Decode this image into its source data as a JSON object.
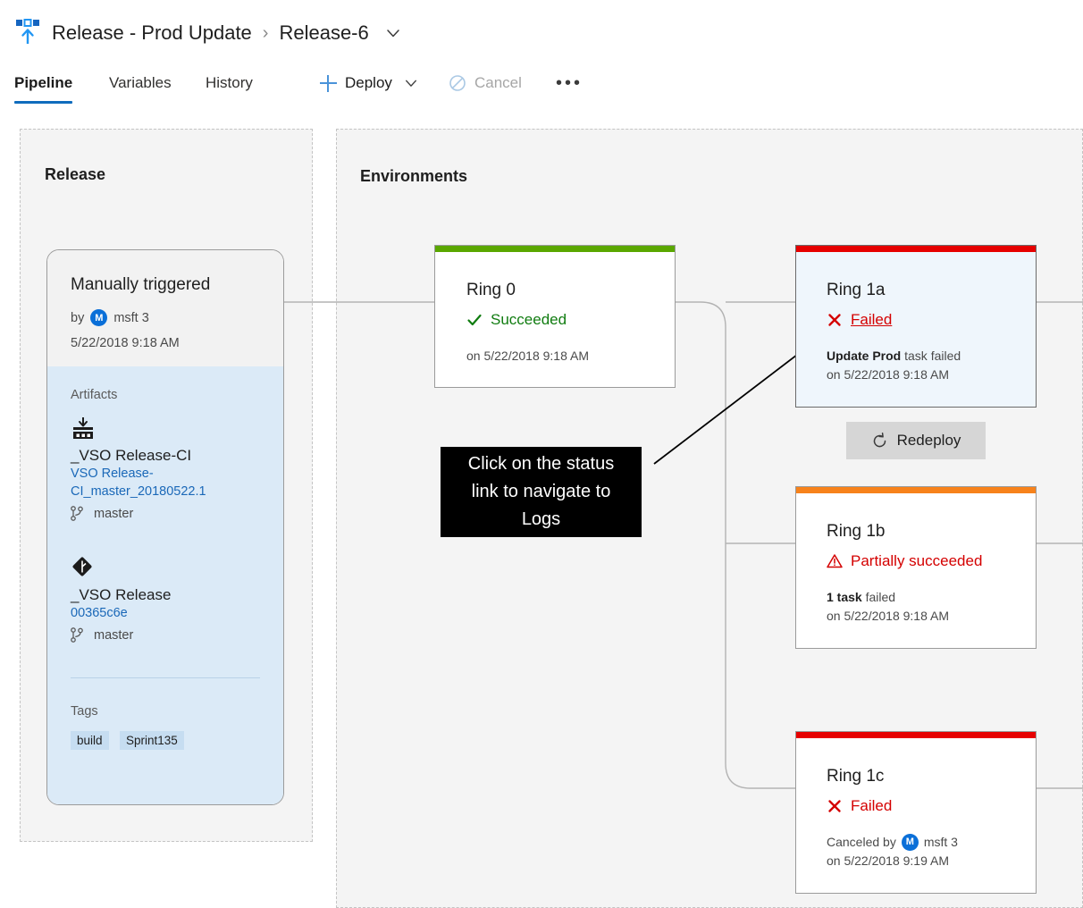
{
  "header": {
    "app_icon": "release-pipeline-icon",
    "breadcrumb_root": "Release - Prod Update",
    "breadcrumb_separator": "›",
    "breadcrumb_current": "Release-6",
    "caret_icon": "chevron-down-icon"
  },
  "tabs": [
    {
      "label": "Pipeline",
      "active": true
    },
    {
      "label": "Variables",
      "active": false
    },
    {
      "label": "History",
      "active": false
    }
  ],
  "toolbar": {
    "deploy_label": "Deploy",
    "deploy_icon": "plus-icon",
    "deploy_caret_icon": "chevron-down-icon",
    "cancel_label": "Cancel",
    "cancel_icon": "block-circle-icon",
    "cancel_disabled": true,
    "more_label": "•••",
    "more_icon": "ellipsis-icon"
  },
  "panels": {
    "release": {
      "title": "Release"
    },
    "environments": {
      "title": "Environments"
    }
  },
  "release_card": {
    "trigger_title": "Manually triggered",
    "by_prefix": "by",
    "by_user": "msft 3",
    "by_avatar_initial": "M",
    "date": "5/22/2018 9:18 AM",
    "artifacts_label": "Artifacts",
    "artifacts": [
      {
        "icon": "build-artifact-icon",
        "name": "_VSO Release-CI",
        "version": "VSO Release-CI_master_20180522.1",
        "branch_icon": "git-branch-icon",
        "branch": "master"
      },
      {
        "icon": "git-repo-icon",
        "name": "_VSO Release",
        "version": "00365c6e",
        "branch_icon": "git-branch-icon",
        "branch": "master"
      }
    ],
    "tags_label": "Tags",
    "tags": [
      "build",
      "Sprint135"
    ]
  },
  "environments": [
    {
      "name": "Ring 0",
      "status": "Succeeded",
      "status_icon": "checkmark-icon",
      "status_color": "#107c10",
      "bar_color": "#5aa700",
      "status_is_link": false,
      "selected": false,
      "meta_prefix": "",
      "meta_bold": "",
      "meta_rest": "",
      "meta_by_user": "",
      "meta_avatar_initial": "",
      "meta_date": "on 5/22/2018 9:18 AM"
    },
    {
      "name": "Ring 1a",
      "status": "Failed",
      "status_icon": "error-x-icon",
      "status_color": "#d40000",
      "bar_color": "#e60000",
      "status_is_link": true,
      "selected": true,
      "meta_prefix": "",
      "meta_bold": "Update Prod",
      "meta_rest": " task failed",
      "meta_by_user": "",
      "meta_avatar_initial": "",
      "meta_date": "on 5/22/2018 9:18 AM"
    },
    {
      "name": "Ring 1b",
      "status": "Partially succeeded",
      "status_icon": "warning-triangle-icon",
      "status_color": "#d40000",
      "bar_color": "#f7821b",
      "status_is_link": false,
      "selected": false,
      "meta_prefix": "",
      "meta_bold": "1 task",
      "meta_rest": " failed",
      "meta_by_user": "",
      "meta_avatar_initial": "",
      "meta_date": "on 5/22/2018 9:18 AM"
    },
    {
      "name": "Ring 1c",
      "status": "Failed",
      "status_icon": "error-x-icon",
      "status_color": "#d40000",
      "bar_color": "#e60000",
      "status_is_link": false,
      "selected": false,
      "meta_prefix": "Canceled by",
      "meta_bold": "",
      "meta_rest": "",
      "meta_by_user": "msft 3",
      "meta_avatar_initial": "M",
      "meta_date": "on 5/22/2018 9:19 AM"
    }
  ],
  "redeploy": {
    "label": "Redeploy",
    "icon": "refresh-circle-icon"
  },
  "callout": {
    "text": "Click on the status link to navigate to Logs"
  },
  "colors": {
    "accent": "#0f6cbd",
    "success": "#5aa700",
    "error": "#e60000",
    "warning": "#f7821b",
    "link": "#1a68b8"
  }
}
